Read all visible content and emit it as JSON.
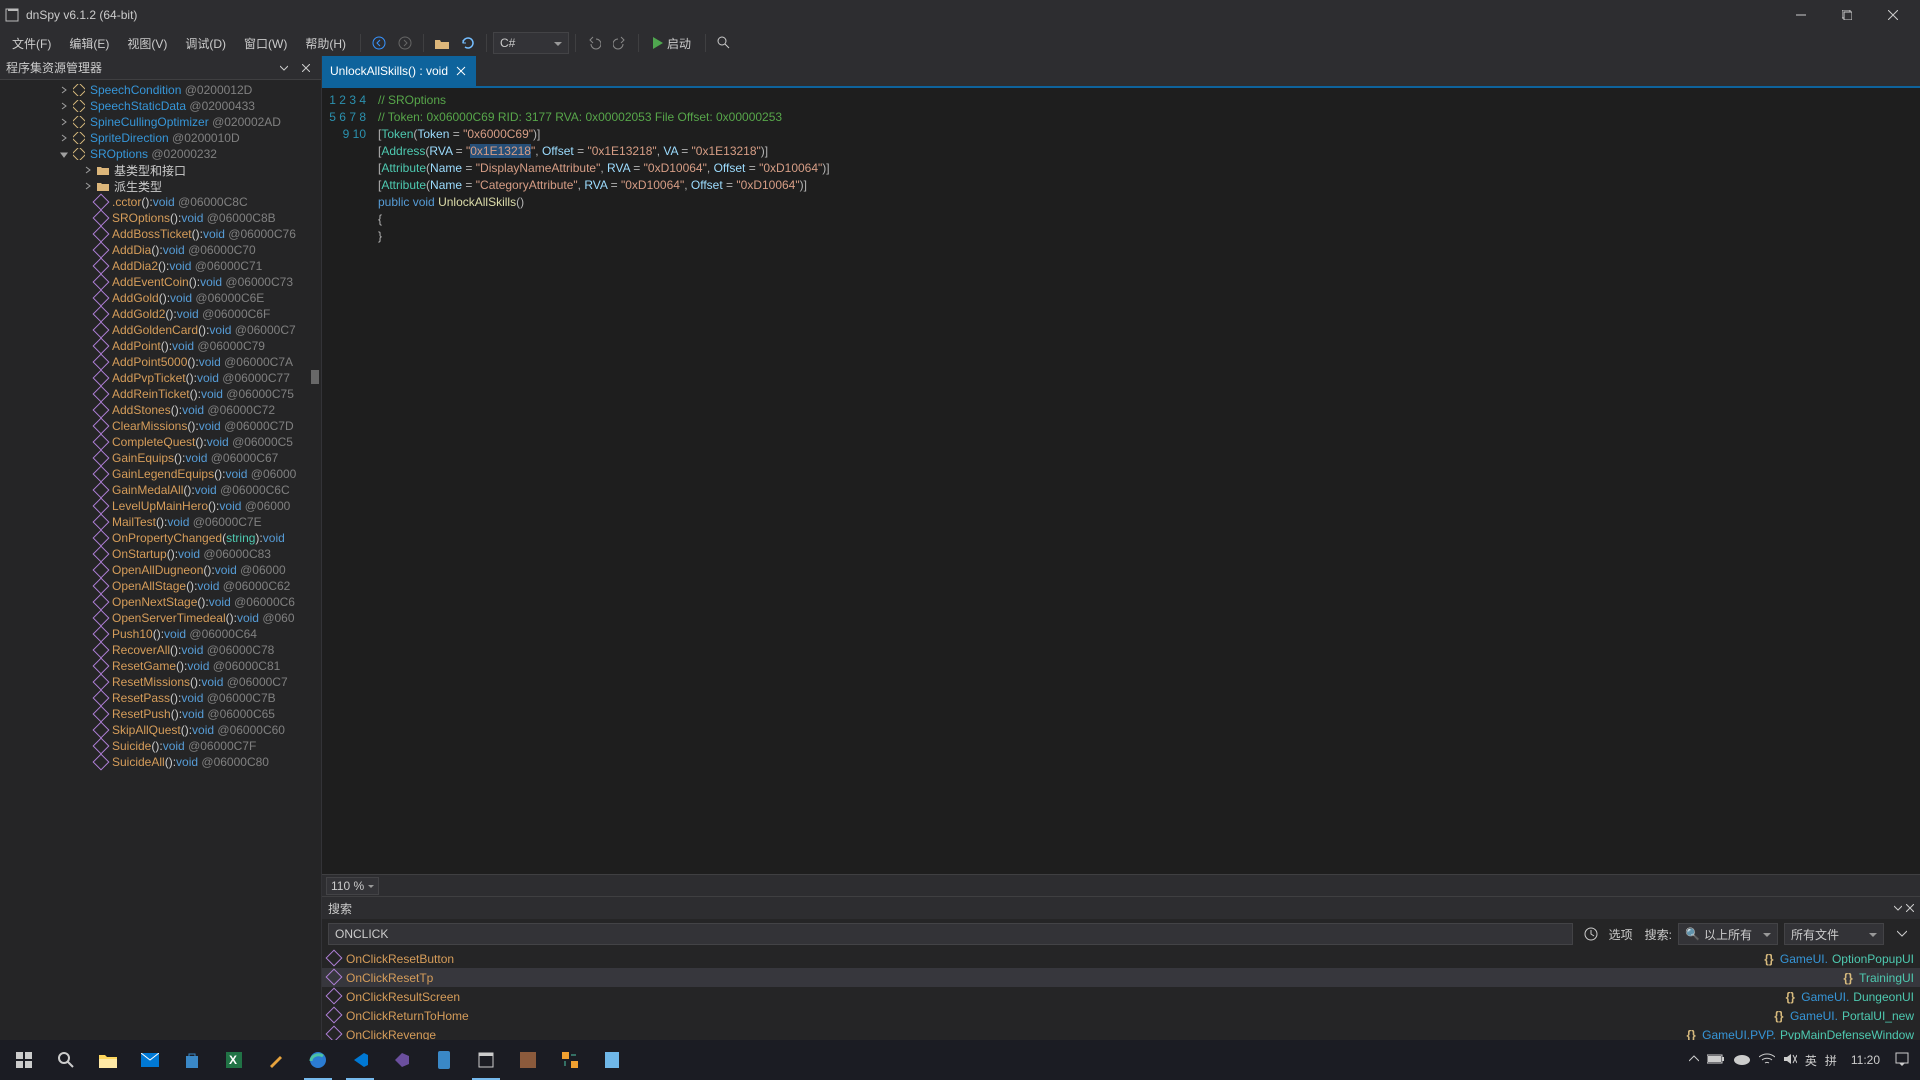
{
  "window": {
    "title": "dnSpy v6.1.2 (64-bit)"
  },
  "menu": {
    "file": "文件(F)",
    "edit": "编辑(E)",
    "view": "视图(V)",
    "debug": "调试(D)",
    "window": "窗口(W)",
    "help": "帮助(H)"
  },
  "toolbar": {
    "lang": "C#",
    "start": "启动"
  },
  "sidebar": {
    "title": "程序集资源管理器",
    "classes": [
      {
        "name": "SpeechCondition",
        "token": "@0200012D"
      },
      {
        "name": "SpeechStaticData",
        "token": "@02000433"
      },
      {
        "name": "SpineCullingOptimizer",
        "token": "@020002AD"
      },
      {
        "name": "SpriteDirection",
        "token": "@0200010D"
      },
      {
        "name": "SROptions",
        "token": "@02000232",
        "expanded": true
      }
    ],
    "folders": [
      {
        "label": "基类型和接口"
      },
      {
        "label": "派生类型"
      }
    ],
    "methods": [
      {
        "name": ".cctor",
        "args": "()",
        "ret": "void",
        "token": "@06000C8C"
      },
      {
        "name": "SROptions",
        "args": "()",
        "ret": "void",
        "token": "@06000C8B"
      },
      {
        "name": "AddBossTicket",
        "args": "()",
        "ret": "void",
        "token": "@06000C76"
      },
      {
        "name": "AddDia",
        "args": "()",
        "ret": "void",
        "token": "@06000C70"
      },
      {
        "name": "AddDia2",
        "args": "()",
        "ret": "void",
        "token": "@06000C71"
      },
      {
        "name": "AddEventCoin",
        "args": "()",
        "ret": "void",
        "token": "@06000C73"
      },
      {
        "name": "AddGold",
        "args": "()",
        "ret": "void",
        "token": "@06000C6E"
      },
      {
        "name": "AddGold2",
        "args": "()",
        "ret": "void",
        "token": "@06000C6F"
      },
      {
        "name": "AddGoldenCard",
        "args": "()",
        "ret": "void",
        "token": "@06000C7"
      },
      {
        "name": "AddPoint",
        "args": "()",
        "ret": "void",
        "token": "@06000C79"
      },
      {
        "name": "AddPoint5000",
        "args": "()",
        "ret": "void",
        "token": "@06000C7A"
      },
      {
        "name": "AddPvpTicket",
        "args": "()",
        "ret": "void",
        "token": "@06000C77"
      },
      {
        "name": "AddReinTicket",
        "args": "()",
        "ret": "void",
        "token": "@06000C75"
      },
      {
        "name": "AddStones",
        "args": "()",
        "ret": "void",
        "token": "@06000C72"
      },
      {
        "name": "ClearMissions",
        "args": "()",
        "ret": "void",
        "token": "@06000C7D"
      },
      {
        "name": "CompleteQuest",
        "args": "()",
        "ret": "void",
        "token": "@06000C5"
      },
      {
        "name": "GainEquips",
        "args": "()",
        "ret": "void",
        "token": "@06000C67"
      },
      {
        "name": "GainLegendEquips",
        "args": "()",
        "ret": "void",
        "token": "@06000"
      },
      {
        "name": "GainMedalAll",
        "args": "()",
        "ret": "void",
        "token": "@06000C6C"
      },
      {
        "name": "LevelUpMainHero",
        "args": "()",
        "ret": "void",
        "token": "@06000"
      },
      {
        "name": "MailTest",
        "args": "()",
        "ret": "void",
        "token": "@06000C7E"
      },
      {
        "name": "OnPropertyChanged",
        "args": "(",
        "param": "string",
        "argsEnd": ")",
        "ret": "void",
        "token": ""
      },
      {
        "name": "OnStartup",
        "args": "()",
        "ret": "void",
        "token": "@06000C83"
      },
      {
        "name": "OpenAllDugneon",
        "args": "()",
        "ret": "void",
        "token": "@06000"
      },
      {
        "name": "OpenAllStage",
        "args": "()",
        "ret": "void",
        "token": "@06000C62"
      },
      {
        "name": "OpenNextStage",
        "args": "()",
        "ret": "void",
        "token": "@06000C6"
      },
      {
        "name": "OpenServerTimedeal",
        "args": "()",
        "ret": "void",
        "token": "@060"
      },
      {
        "name": "Push10",
        "args": "()",
        "ret": "void",
        "token": "@06000C64"
      },
      {
        "name": "RecoverAll",
        "args": "()",
        "ret": "void",
        "token": "@06000C78"
      },
      {
        "name": "ResetGame",
        "args": "()",
        "ret": "void",
        "token": "@06000C81"
      },
      {
        "name": "ResetMissions",
        "args": "()",
        "ret": "void",
        "token": "@06000C7"
      },
      {
        "name": "ResetPass",
        "args": "()",
        "ret": "void",
        "token": "@06000C7B"
      },
      {
        "name": "ResetPush",
        "args": "()",
        "ret": "void",
        "token": "@06000C65"
      },
      {
        "name": "SkipAllQuest",
        "args": "()",
        "ret": "void",
        "token": "@06000C60"
      },
      {
        "name": "Suicide",
        "args": "()",
        "ret": "void",
        "token": "@06000C7F"
      },
      {
        "name": "SuicideAll",
        "args": "()",
        "ret": "void",
        "token": "@06000C80"
      }
    ]
  },
  "tab": {
    "label": "UnlockAllSkills() : void"
  },
  "code": {
    "line1": "// SROptions",
    "line2": "// Token: 0x06000C69 RID: 3177 RVA: 0x00002053 File Offset: 0x00000253",
    "tok_l": "[",
    "tok_r": "]",
    "token_attr": "Token",
    "token_p": "Token",
    "token_val": "\"0x6000C69\"",
    "addr_attr": "Address",
    "rva": "RVA",
    "rva_val": "\"0x1E13218\"",
    "offset": "Offset",
    "offset_val": "\"0x1E13218\"",
    "va": "VA",
    "va_val": "\"0x1E13218\"",
    "attr": "Attribute",
    "name_p": "Name",
    "disp_val": "\"DisplayNameAttribute\"",
    "rva2_val": "\"0xD10064\"",
    "off2_val": "\"0xD10064\"",
    "cat_val": "\"CategoryAttribute\"",
    "public": "public",
    "void": "void",
    "method": "UnlockAllSkills",
    "parens": "()",
    "brace_o": "{",
    "brace_c": "}"
  },
  "zoom": {
    "value": "110 %"
  },
  "search": {
    "title": "搜索",
    "input": "ONCLICK",
    "opts_label": "选项",
    "search_label": "搜索:",
    "scope1": "以上所有",
    "scope2": "所有文件",
    "results": [
      {
        "name": "OnClickResetButton",
        "ns": "GameUI",
        "cls": "OptionPopupUI"
      },
      {
        "name": "OnClickResetTp",
        "ns": "",
        "cls": "TrainingUI",
        "selected": true
      },
      {
        "name": "OnClickResultScreen",
        "ns": "GameUI",
        "cls": "DungeonUI"
      },
      {
        "name": "OnClickReturnToHome",
        "ns": "GameUI",
        "cls": "PortalUI_new"
      },
      {
        "name": "OnClickRevenge",
        "ns": "GameUI.PVP",
        "cls": "PvpMainDefenseWindow"
      }
    ]
  },
  "taskbar": {
    "clock": "11:20",
    "ime1": "英",
    "ime2": "拼"
  }
}
